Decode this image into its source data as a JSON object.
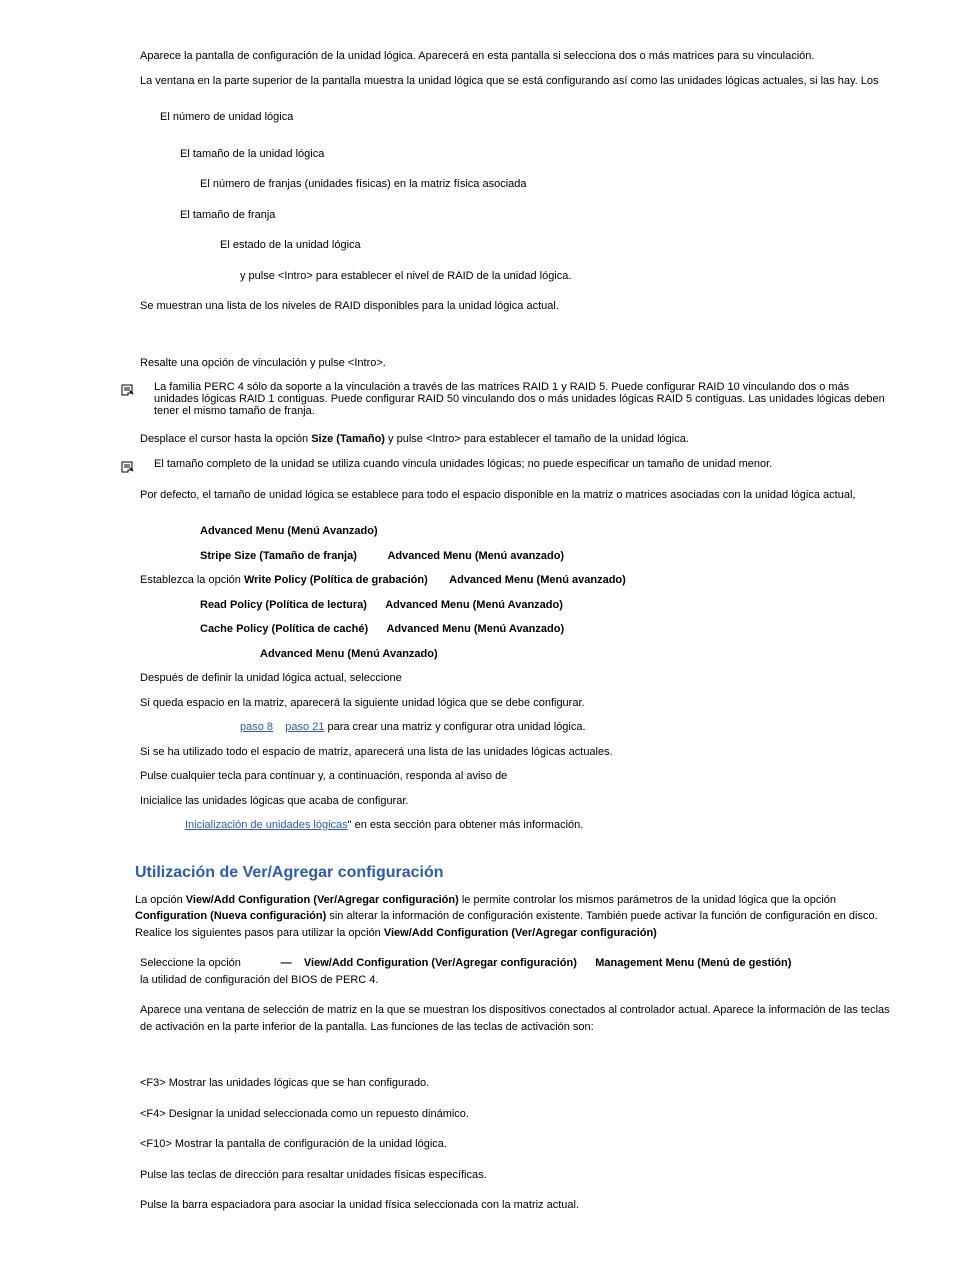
{
  "p1": "Aparece la pantalla de configuración de la unidad lógica. Aparecerá                  en esta pantalla si selecciona dos o más matrices para su vinculación.",
  "p2": "La ventana en la parte superior de la pantalla muestra la unidad lógica que se está configurando así como las unidades lógicas actuales, si las hay. Los",
  "li1": "El número de unidad lógica",
  "li2": "El tamaño de la unidad lógica",
  "li3": "El número de franjas (unidades físicas) en la matriz física asociada",
  "li4": "El tamaño de franja",
  "li5": "El estado de la unidad lógica",
  "li6": " y pulse <Intro> para establecer el nivel de RAID de la unidad lógica.",
  "p3": "Se muestran una lista de los niveles de RAID disponibles para la unidad lógica actual.",
  "p4": "Resalte una opción de vinculación y pulse <Intro>.",
  "note1": "La familia PERC 4 sólo da soporte a la vinculación a través de las matrices RAID 1 y RAID 5. Puede configurar RAID 10 vinculando dos o más unidades lógicas RAID 1 contiguas. Puede configurar RAID 50 vinculando dos o más unidades lógicas RAID 5 contiguas. Las unidades lógicas deben tener el mismo tamaño de franja.",
  "p5a": "Desplace el cursor hasta la opción ",
  "p5b": "Size (Tamaño)",
  "p5c": " y pulse <Intro> para establecer el tamaño de la unidad lógica.",
  "note2": "El tamaño completo de la unidad se utiliza cuando vincula unidades lógicas; no puede especificar un tamaño de unidad menor.",
  "p6": "Por defecto, el tamaño de unidad lógica se establece para todo el espacio disponible en la matriz o matrices asociadas con la unidad lógica actual,",
  "t1": "Advanced Menu (Menú Avanzado)",
  "t2a": "Stripe Size (Tamaño de franja)",
  "t2b": "Advanced Menu (Menú avanzado)",
  "t3a": "Establezca la opción ",
  "t3b": "Write Policy (Política de grabación)",
  "t3c": "Advanced Menu (Menú avanzado)",
  "t4a": "Read Policy (Política de lectura)",
  "t4b": "Advanced Menu (Menú Avanzado)",
  "t5a": "Cache Policy (Política de caché)",
  "t5b": "Advanced Menu (Menú Avanzado)",
  "t6": "Advanced Menu (Menú Avanzado)",
  "p7": "Después de definir la unidad lógica actual, seleccione",
  "p8": "Si queda espacio en la matriz, aparecerá la siguiente unidad lógica que se debe configurar.",
  "link1": "paso 8",
  "link2": "paso 21",
  "p9b": " para crear una matriz y configurar otra unidad lógica.",
  "p10": "Si se ha utilizado todo el espacio de matriz, aparecerá una lista de las unidades lógicas actuales.",
  "p11": "Pulse cualquier tecla para continuar y, a continuación, responda al aviso de",
  "p12": "Inicialice las unidades lógicas que acaba de configurar.",
  "link3": "Inicialización de unidades lógicas",
  "p13b": "\" en esta sección para obtener más información.",
  "h2": "Utilización de Ver/Agregar configuración",
  "intro_a": "La opción ",
  "intro_b": "View/Add Configuration (Ver/Agregar configuración)",
  "intro_c": " le permite controlar los mismos parámetros de la unidad lógica que la opción ",
  "intro_d": "Configuration (Nueva configuración)",
  "intro_e": " sin alterar la información de configuración existente. También puede activar la función de configuración en disco. Realice los siguientes pasos para utilizar la opción ",
  "intro_f": "View/Add Configuration (Ver/Agregar configuración)",
  "s1a": "Seleccione la opción ",
  "s1b": "—",
  "s1c": "View/Add Configuration (Ver/Agregar configuración)",
  "s1d": "Management Menu (Menú de gestión)",
  "s1e": "la utilidad de configuración del BIOS de PERC 4.",
  "s2": "Aparece una ventana de selección de matriz en la que se muestran los dispositivos conectados al controlador actual. Aparece la información de las teclas de activación en la parte inferior de la pantalla. Las funciones de las teclas de activación son:",
  "f3": "<F3> Mostrar las unidades lógicas que se han configurado.",
  "f4": "<F4> Designar la unidad seleccionada como un repuesto dinámico.",
  "f10": "<F10> Mostrar la pantalla de configuración de la unidad lógica.",
  "arrow": "Pulse las teclas de dirección para resaltar unidades físicas específicas.",
  "space": "Pulse la barra espaciadora para asociar la unidad física seleccionada con la matriz actual."
}
